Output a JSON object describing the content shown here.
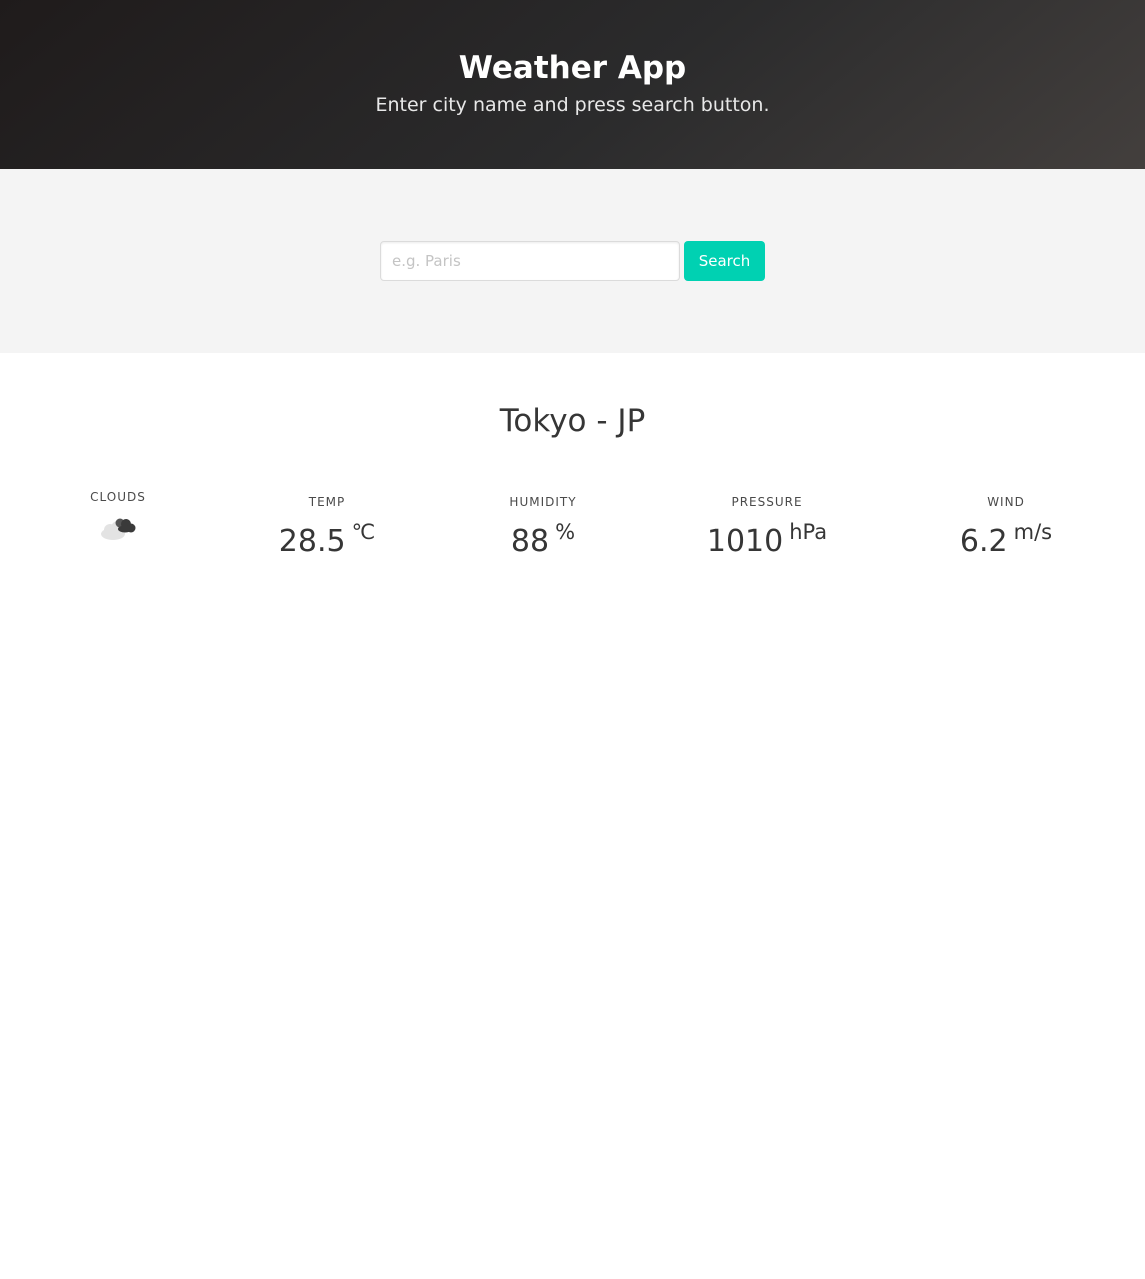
{
  "header": {
    "title": "Weather App",
    "subtitle": "Enter city name and press search button."
  },
  "search": {
    "placeholder": "e.g. Paris",
    "value": "",
    "button_label": "Search",
    "button_color": "#00d1b2"
  },
  "result": {
    "city": "Tokyo - JP",
    "condition": {
      "label": "Clouds",
      "icon": "broken-clouds-icon"
    },
    "temp": {
      "label": "Temp",
      "value": "28.5",
      "unit": "℃"
    },
    "humidity": {
      "label": "Humidity",
      "value": "88",
      "unit": "%"
    },
    "pressure": {
      "label": "Pressure",
      "value": "1010",
      "unit": "hPa"
    },
    "wind": {
      "label": "Wind",
      "value": "6.2",
      "unit": "m/s"
    }
  }
}
